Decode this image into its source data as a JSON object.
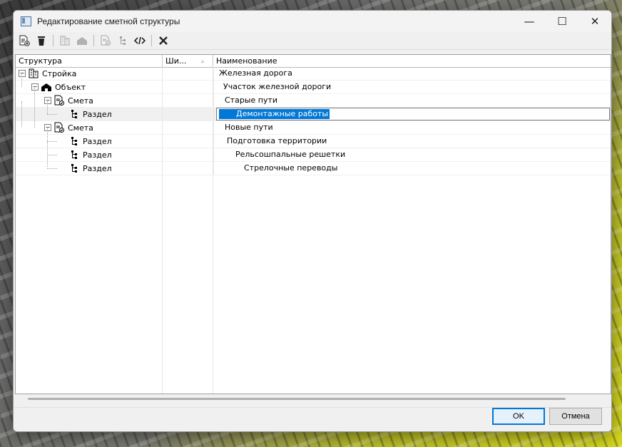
{
  "window": {
    "title": "Редактирование сметной структуры",
    "minimize_glyph": "—",
    "maximize_glyph": "☐",
    "close_glyph": "✕"
  },
  "toolbar": {
    "buttons": [
      {
        "icon": "add-document-icon",
        "enabled": true
      },
      {
        "icon": "trash-icon",
        "enabled": true
      },
      {
        "icon": "building-icon",
        "enabled": false
      },
      {
        "icon": "house-icon",
        "enabled": false
      },
      {
        "icon": "estimate-icon",
        "enabled": false
      },
      {
        "icon": "section-icon",
        "enabled": false
      },
      {
        "icon": "code-icon",
        "enabled": true
      },
      {
        "icon": "close-x-icon",
        "enabled": true
      }
    ]
  },
  "grid": {
    "columns": {
      "structure": "Структура",
      "width": "Ши...",
      "width_sort": "▵",
      "name": "Наименование"
    },
    "rows": [
      {
        "level": 0,
        "type": "Стройка",
        "name": "Железная дорога",
        "icon": "building-icon",
        "expander": "⊟"
      },
      {
        "level": 1,
        "type": "Объект",
        "name": "Участок железной дороги",
        "icon": "house-icon",
        "expander": "⊟"
      },
      {
        "level": 2,
        "type": "Смета",
        "name": "Старые пути",
        "icon": "estimate-icon",
        "expander": "⊟"
      },
      {
        "level": 3,
        "type": "Раздел",
        "name": "Демонтажные работы",
        "icon": "section-icon",
        "expander": "",
        "selected": true,
        "editing": true
      },
      {
        "level": 2,
        "type": "Смета",
        "name": "Новые пути",
        "icon": "estimate-icon",
        "expander": "⊟"
      },
      {
        "level": 3,
        "type": "Раздел",
        "name": "Подготовка территории",
        "icon": "section-icon",
        "expander": ""
      },
      {
        "level": 3,
        "type": "Раздел",
        "name": "Рельсошпальные решетки",
        "icon": "section-icon",
        "expander": ""
      },
      {
        "level": 3,
        "type": "Раздел",
        "name": "Стрелочные переводы",
        "icon": "section-icon",
        "expander": ""
      }
    ]
  },
  "footer": {
    "ok_label": "OK",
    "cancel_label": "Отмена"
  },
  "colors": {
    "selection": "#0078d7",
    "window_bg": "#f0f0f0"
  }
}
